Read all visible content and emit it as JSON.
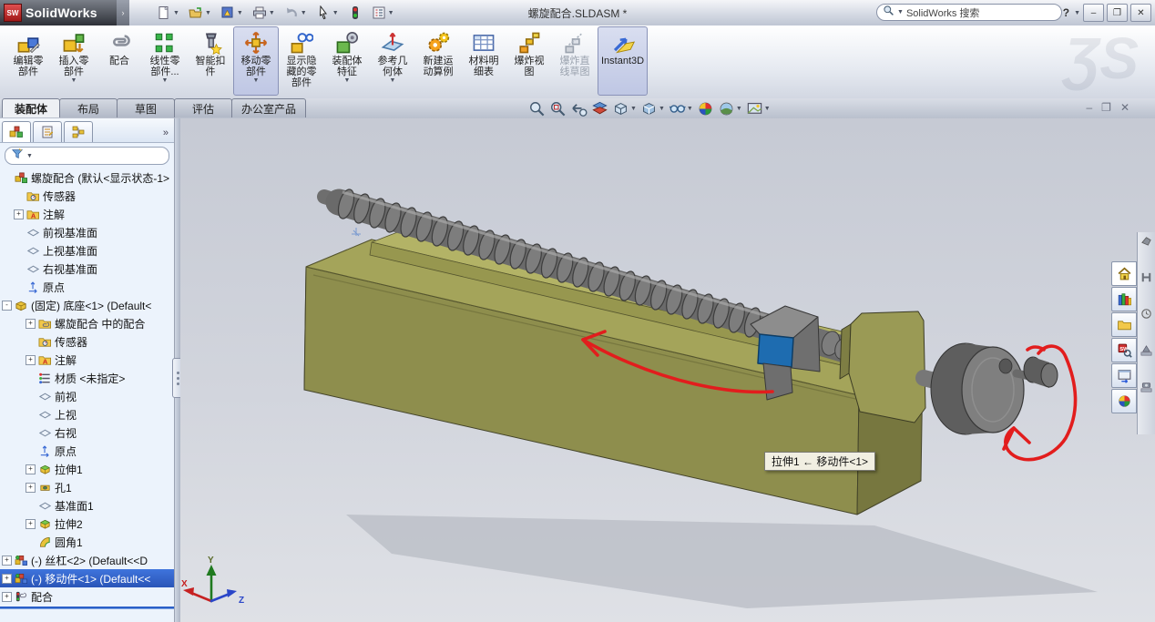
{
  "window": {
    "app_name": "SolidWorks",
    "logo_mark": "SW",
    "title": "螺旋配合.SLDASM *",
    "search_placeholder": "SolidWorks 搜索",
    "help_label": "?",
    "minimize": "–",
    "restore": "❐",
    "close": "✕"
  },
  "titlebar_tools": [
    {
      "name": "new-document",
      "icon": "new-doc",
      "dropdown": true
    },
    {
      "name": "open-document",
      "icon": "open",
      "dropdown": true
    },
    {
      "name": "publish-edrawing",
      "icon": "publish",
      "dropdown": true
    },
    {
      "name": "print",
      "icon": "print",
      "dropdown": true
    },
    {
      "name": "undo",
      "icon": "undo",
      "dropdown": true
    },
    {
      "name": "select",
      "icon": "cursor",
      "dropdown": true
    },
    {
      "name": "rebuild",
      "icon": "rebuild",
      "dropdown": false
    },
    {
      "name": "options",
      "icon": "options-list",
      "dropdown": true
    }
  ],
  "ribbon": {
    "watermark": "ƷS",
    "buttons": [
      {
        "name": "edit-component",
        "label": "编辑零\n部件",
        "icon": "edit-comp",
        "dropdown": false,
        "active": false,
        "disabled": false
      },
      {
        "name": "insert-components",
        "label": "插入零\n部件",
        "icon": "insert-comp",
        "dropdown": true,
        "active": false,
        "disabled": false
      },
      {
        "name": "mate",
        "label": "配合",
        "icon": "mate-clip",
        "dropdown": false,
        "active": false,
        "disabled": false
      },
      {
        "name": "linear-component-pattern",
        "label": "线性零\n部件...",
        "icon": "linear-pattern",
        "dropdown": true,
        "active": false,
        "disabled": false
      },
      {
        "name": "smart-fasteners",
        "label": "智能扣\n件",
        "icon": "smart-fastener",
        "dropdown": false,
        "active": false,
        "disabled": false
      },
      {
        "name": "move-component",
        "label": "移动零\n部件",
        "icon": "move-comp",
        "dropdown": true,
        "active": true,
        "disabled": false
      },
      {
        "name": "show-hidden-components",
        "label": "显示隐\n藏的零\n部件",
        "icon": "show-hidden",
        "dropdown": false,
        "active": false,
        "disabled": false
      },
      {
        "name": "assembly-features",
        "label": "装配体\n特征",
        "icon": "asm-features",
        "dropdown": true,
        "active": false,
        "disabled": false
      },
      {
        "name": "reference-geometry",
        "label": "参考几\n何体",
        "icon": "ref-geo",
        "dropdown": true,
        "active": false,
        "disabled": false
      },
      {
        "name": "new-motion-study",
        "label": "新建运\n动算例",
        "icon": "motion",
        "dropdown": false,
        "active": false,
        "disabled": false
      },
      {
        "name": "bill-of-materials",
        "label": "材料明\n细表",
        "icon": "bom",
        "dropdown": false,
        "active": false,
        "disabled": false
      },
      {
        "name": "exploded-view",
        "label": "爆炸视\n图",
        "icon": "explode-view",
        "dropdown": false,
        "active": false,
        "disabled": false
      },
      {
        "name": "explode-line-sketch",
        "label": "爆炸直\n线草图",
        "icon": "explode-sketch",
        "dropdown": false,
        "active": false,
        "disabled": true
      },
      {
        "name": "instant3d",
        "label": "Instant3D",
        "icon": "instant3d",
        "dropdown": false,
        "active": true,
        "disabled": false
      }
    ]
  },
  "command_tabs": [
    {
      "name": "tab-assembly",
      "label": "装配体",
      "active": true
    },
    {
      "name": "tab-layout",
      "label": "布局",
      "active": false
    },
    {
      "name": "tab-sketch",
      "label": "草图",
      "active": false
    },
    {
      "name": "tab-evaluate",
      "label": "评估",
      "active": false
    },
    {
      "name": "tab-office",
      "label": "办公室产品",
      "active": false
    }
  ],
  "headsup_tools": [
    {
      "name": "zoom-to-fit",
      "icon": "zoom-fit",
      "dropdown": false
    },
    {
      "name": "zoom-to-area",
      "icon": "zoom-area",
      "dropdown": false
    },
    {
      "name": "previous-view",
      "icon": "prev-view",
      "dropdown": false
    },
    {
      "name": "section-view",
      "icon": "section-view",
      "dropdown": false
    },
    {
      "name": "view-orientation",
      "icon": "view-orient",
      "dropdown": true
    },
    {
      "name": "display-style",
      "icon": "display-style",
      "dropdown": true
    },
    {
      "name": "hide-show-items",
      "icon": "hide-items",
      "dropdown": true
    },
    {
      "name": "edit-appearance",
      "icon": "appearance",
      "dropdown": false
    },
    {
      "name": "apply-scene",
      "icon": "scene",
      "dropdown": true
    },
    {
      "name": "view-settings",
      "icon": "view-settings",
      "dropdown": true
    }
  ],
  "doc_controls": {
    "minimize": "–",
    "restore": "❐",
    "close": "✕"
  },
  "panel": {
    "tabs": [
      {
        "name": "featuremanager-tab",
        "icon": "pt-asm",
        "active": true
      },
      {
        "name": "propertymanager-tab",
        "icon": "pt-props",
        "active": false
      },
      {
        "name": "configurationmanager-tab",
        "icon": "pt-config",
        "active": false
      }
    ],
    "chevron": "»",
    "filter_icon": "funnel",
    "tree": [
      {
        "name": "root-assembly",
        "label": "螺旋配合 (默认<显示状态-1>",
        "icon": "asm-root",
        "expand": "",
        "indent": 0,
        "selected": false
      },
      {
        "name": "sensors",
        "label": "传感器",
        "icon": "sensors",
        "expand": "",
        "indent": 1,
        "selected": false
      },
      {
        "name": "annotations",
        "label": "注解",
        "icon": "annotations",
        "expand": "+",
        "indent": 1,
        "selected": false
      },
      {
        "name": "front-plane",
        "label": "前视基准面",
        "icon": "plane",
        "expand": "",
        "indent": 1,
        "selected": false
      },
      {
        "name": "top-plane",
        "label": "上视基准面",
        "icon": "plane",
        "expand": "",
        "indent": 1,
        "selected": false
      },
      {
        "name": "right-plane",
        "label": "右视基准面",
        "icon": "plane",
        "expand": "",
        "indent": 1,
        "selected": false
      },
      {
        "name": "origin",
        "label": "原点",
        "icon": "origin",
        "expand": "",
        "indent": 1,
        "selected": false
      },
      {
        "name": "component-base",
        "label": "(固定) 底座<1> (Default<",
        "icon": "part",
        "expand": "-",
        "indent": 0,
        "selected": false
      },
      {
        "name": "mates-in-assembly",
        "label": "螺旋配合 中的配合",
        "icon": "matefolder",
        "expand": "+",
        "indent": 2,
        "selected": false
      },
      {
        "name": "base-sensors",
        "label": "传感器",
        "icon": "sensors",
        "expand": "",
        "indent": 2,
        "selected": false
      },
      {
        "name": "base-annotations",
        "label": "注解",
        "icon": "annotations",
        "expand": "+",
        "indent": 2,
        "selected": false
      },
      {
        "name": "material",
        "label": "材质 <未指定>",
        "icon": "material",
        "expand": "",
        "indent": 2,
        "selected": false
      },
      {
        "name": "base-front-plane",
        "label": "前视",
        "icon": "plane",
        "expand": "",
        "indent": 2,
        "selected": false
      },
      {
        "name": "base-top-plane",
        "label": "上视",
        "icon": "plane",
        "expand": "",
        "indent": 2,
        "selected": false
      },
      {
        "name": "base-right-plane",
        "label": "右视",
        "icon": "plane",
        "expand": "",
        "indent": 2,
        "selected": false
      },
      {
        "name": "base-origin",
        "label": "原点",
        "icon": "origin",
        "expand": "",
        "indent": 2,
        "selected": false
      },
      {
        "name": "extrude1",
        "label": "拉伸1",
        "icon": "extrude",
        "expand": "+",
        "indent": 2,
        "selected": false
      },
      {
        "name": "hole1",
        "label": "孔1",
        "icon": "hole",
        "expand": "+",
        "indent": 2,
        "selected": false
      },
      {
        "name": "plane1",
        "label": "基准面1",
        "icon": "plane",
        "expand": "",
        "indent": 2,
        "selected": false
      },
      {
        "name": "extrude2",
        "label": "拉伸2",
        "icon": "extrude",
        "expand": "+",
        "indent": 2,
        "selected": false
      },
      {
        "name": "fillet1",
        "label": "圆角1",
        "icon": "fillet",
        "expand": "",
        "indent": 2,
        "selected": false
      },
      {
        "name": "component-screw",
        "label": "(-) 丝杠<2> (Default<<D",
        "icon": "part2",
        "expand": "+",
        "indent": 0,
        "selected": false
      },
      {
        "name": "component-mover",
        "label": "(-) 移动件<1> (Default<<",
        "icon": "part2",
        "expand": "+",
        "indent": 0,
        "selected": true
      },
      {
        "name": "mates-group",
        "label": "配合",
        "icon": "mates",
        "expand": "+",
        "indent": 0,
        "selected": false
      }
    ]
  },
  "taskpane": {
    "tabs": [
      {
        "name": "solidworks-resources-tab",
        "icon": "tp-home",
        "active": true
      },
      {
        "name": "design-library-tab",
        "icon": "tp-library",
        "active": false
      },
      {
        "name": "file-explorer-tab",
        "icon": "tp-folder",
        "active": false
      },
      {
        "name": "search-tab",
        "icon": "tp-search",
        "active": false
      },
      {
        "name": "view-palette-tab",
        "icon": "tp-palette",
        "active": false
      },
      {
        "name": "appearances-scenes-tab",
        "icon": "tp-appearance",
        "active": false
      }
    ],
    "strip_icons": [
      "ts-part",
      "ts-h",
      "ts-clock",
      "ts-pyramid",
      "ts-camera"
    ]
  },
  "viewport": {
    "tooltip": "拉伸1 ← 移动件<1>",
    "triad": {
      "x": "X",
      "y": "Y",
      "z": "Z"
    },
    "colors": {
      "base_olive": "#8e8e4d",
      "screw_gray": "#7a7a7a",
      "selected_face_blue": "#1e6cb0",
      "annotation_red": "#e21d1d"
    }
  }
}
